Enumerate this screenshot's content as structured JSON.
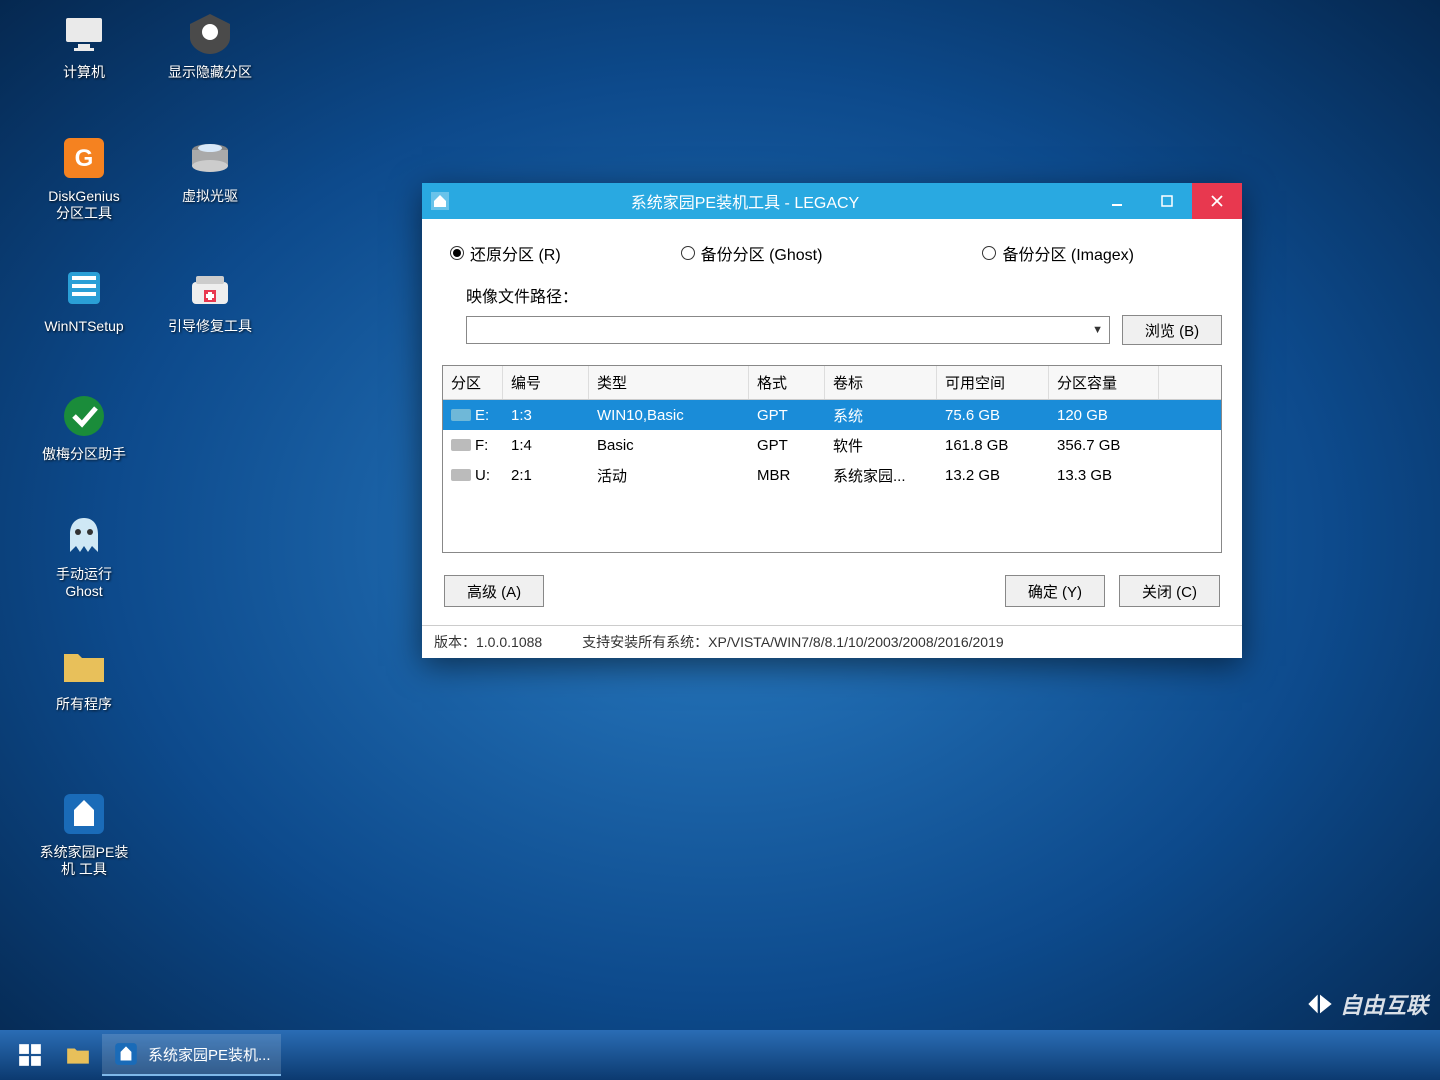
{
  "desktop": {
    "icons": [
      {
        "label": "计算机"
      },
      {
        "label": "显示隐藏分区"
      },
      {
        "label": "DiskGenius\n分区工具"
      },
      {
        "label": "虚拟光驱"
      },
      {
        "label": "WinNTSetup"
      },
      {
        "label": "引导修复工具"
      },
      {
        "label": "傲梅分区助手"
      },
      {
        "label": "手动运行\nGhost"
      },
      {
        "label": "所有程序"
      },
      {
        "label": "系统家园PE装\n机 工具"
      }
    ]
  },
  "window": {
    "title": "系统家园PE装机工具 - LEGACY",
    "radios": {
      "restore": "还原分区 (R)",
      "backup_ghost": "备份分区 (Ghost)",
      "backup_imagex": "备份分区 (Imagex)"
    },
    "path_label": "映像文件路径：",
    "browse": "浏览 (B)",
    "table": {
      "headers": {
        "partition": "分区",
        "number": "编号",
        "type": "类型",
        "format": "格式",
        "label": "卷标",
        "free": "可用空间",
        "capacity": "分区容量"
      },
      "rows": [
        {
          "drive": "E:",
          "number": "1:3",
          "type": "WIN10,Basic",
          "format": "GPT",
          "label": "系统",
          "free": "75.6 GB",
          "capacity": "120 GB",
          "selected": true
        },
        {
          "drive": "F:",
          "number": "1:4",
          "type": "Basic",
          "format": "GPT",
          "label": "软件",
          "free": "161.8 GB",
          "capacity": "356.7 GB",
          "selected": false
        },
        {
          "drive": "U:",
          "number": "2:1",
          "type": "活动",
          "format": "MBR",
          "label": "系统家园...",
          "free": "13.2 GB",
          "capacity": "13.3 GB",
          "selected": false
        }
      ]
    },
    "buttons": {
      "advanced": "高级 (A)",
      "ok": "确定 (Y)",
      "close": "关闭 (C)"
    },
    "status": {
      "version": "版本：1.0.0.1088",
      "support": "支持安装所有系统：XP/VISTA/WIN7/8/8.1/10/2003/2008/2016/2019"
    }
  },
  "taskbar": {
    "app": "系统家园PE装机..."
  },
  "watermark": "自由互联"
}
